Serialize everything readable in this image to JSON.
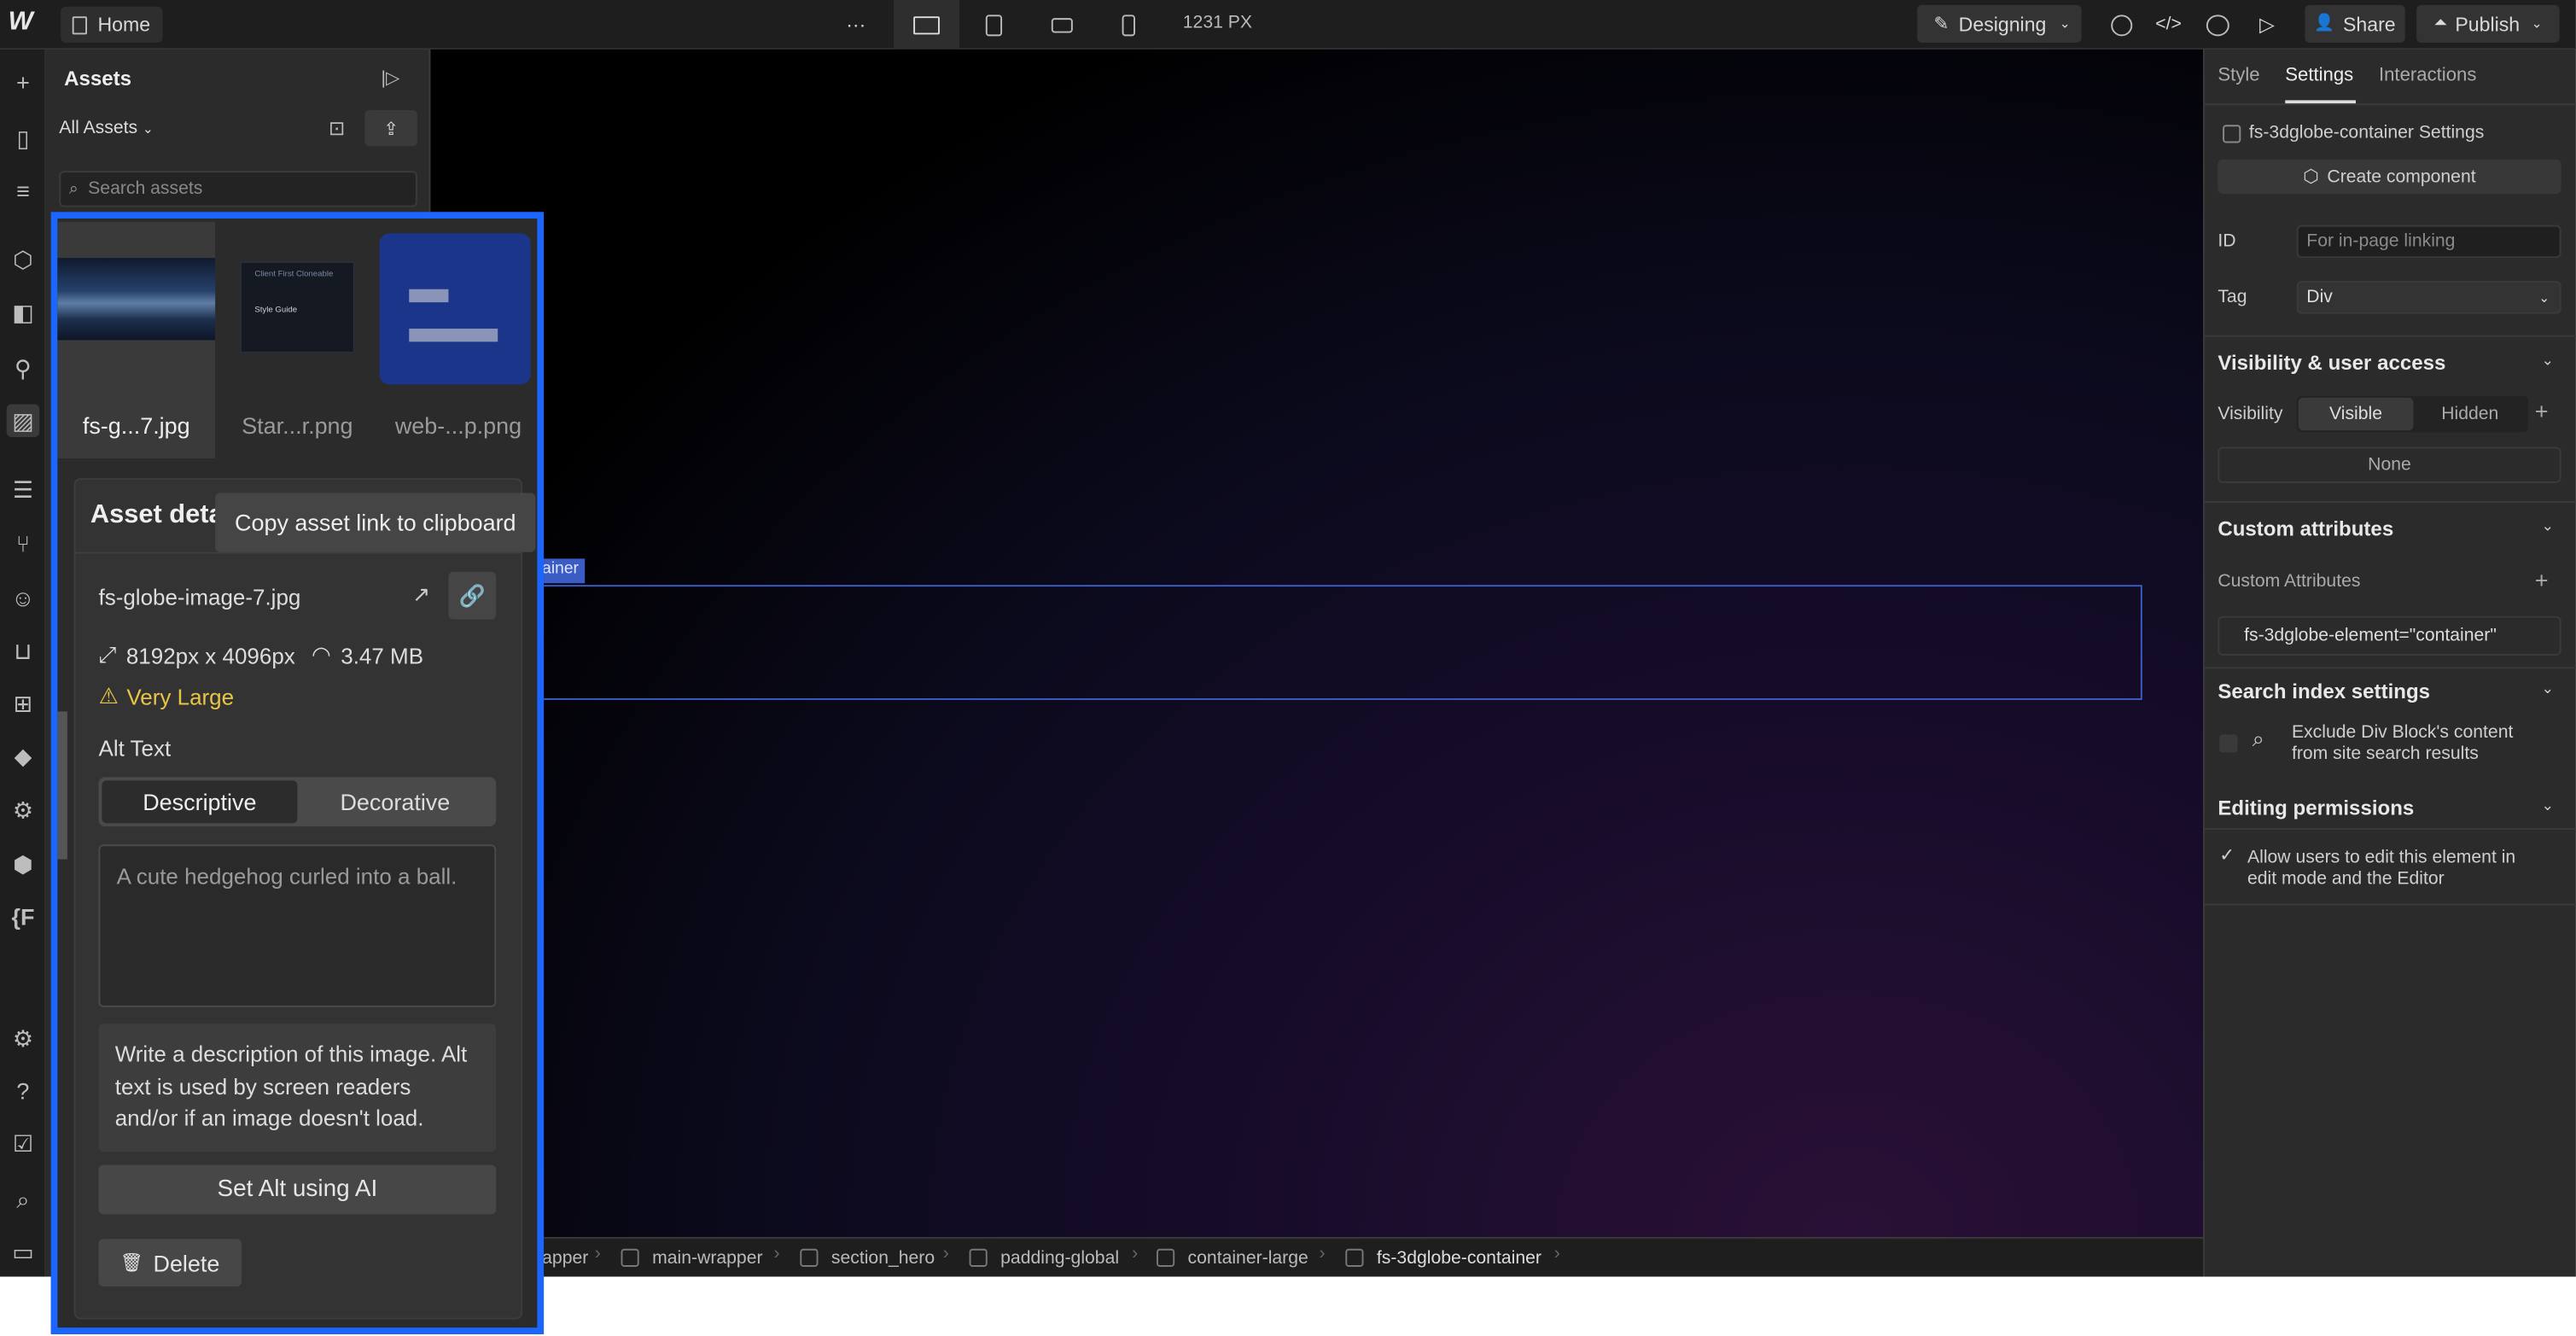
{
  "topbar": {
    "home_label": "Home",
    "more_label": "···",
    "width_readout": "1231 PX",
    "designing_label": "Designing",
    "share_label": "Share",
    "publish_label": "Publish"
  },
  "assets_panel": {
    "title": "Assets",
    "filter_label": "All Assets",
    "search_placeholder": "Search assets",
    "thumbnails": [
      {
        "label": "fs-g...7.jpg"
      },
      {
        "label": "Star...r.png",
        "preview_heading": "Client First Cloneable",
        "preview_sub": "Style Guide"
      },
      {
        "label": "web-...p.png"
      }
    ]
  },
  "asset_details": {
    "heading": "Asset deta",
    "tooltip": "Copy asset link to clipboard",
    "file_name": "fs-globe-image-7.jpg",
    "dimensions": "8192px x 4096px",
    "file_size": "3.47 MB",
    "warning": "Very Large",
    "alt_text_label": "Alt Text",
    "alt_modes": [
      "Descriptive",
      "Decorative"
    ],
    "alt_placeholder": "A cute hedgehog curled into a ball.",
    "help_text": "Write a description of this image. Alt text is used by screen readers and/or if an image doesn't load.",
    "ai_button": "Set Alt using AI",
    "delete_button": "Delete"
  },
  "canvas": {
    "element_label": "ainer"
  },
  "breadcrumb": [
    "apper",
    "main-wrapper",
    "section_hero",
    "padding-global",
    "container-large",
    "fs-3dglobe-container"
  ],
  "settings_panel": {
    "tabs": [
      "Style",
      "Settings",
      "Interactions"
    ],
    "element_settings": "fs-3dglobe-container Settings",
    "create_component": "Create component",
    "id_label": "ID",
    "id_placeholder": "For in-page linking",
    "tag_label": "Tag",
    "tag_value": "Div",
    "visibility_section": "Visibility & user access",
    "visibility_label": "Visibility",
    "visibility_options": [
      "Visible",
      "Hidden"
    ],
    "visibility_none": "None",
    "custom_attributes_section": "Custom attributes",
    "custom_attributes_label": "Custom Attributes",
    "custom_attribute_value": "fs-3dglobe-element=\"container\"",
    "search_index_section": "Search index settings",
    "search_index_line1": "Exclude Div Block's content",
    "search_index_line2": "from site search results",
    "editing_section": "Editing permissions",
    "editing_line1": "Allow users to edit this element in",
    "editing_line2": "edit mode and the Editor"
  }
}
